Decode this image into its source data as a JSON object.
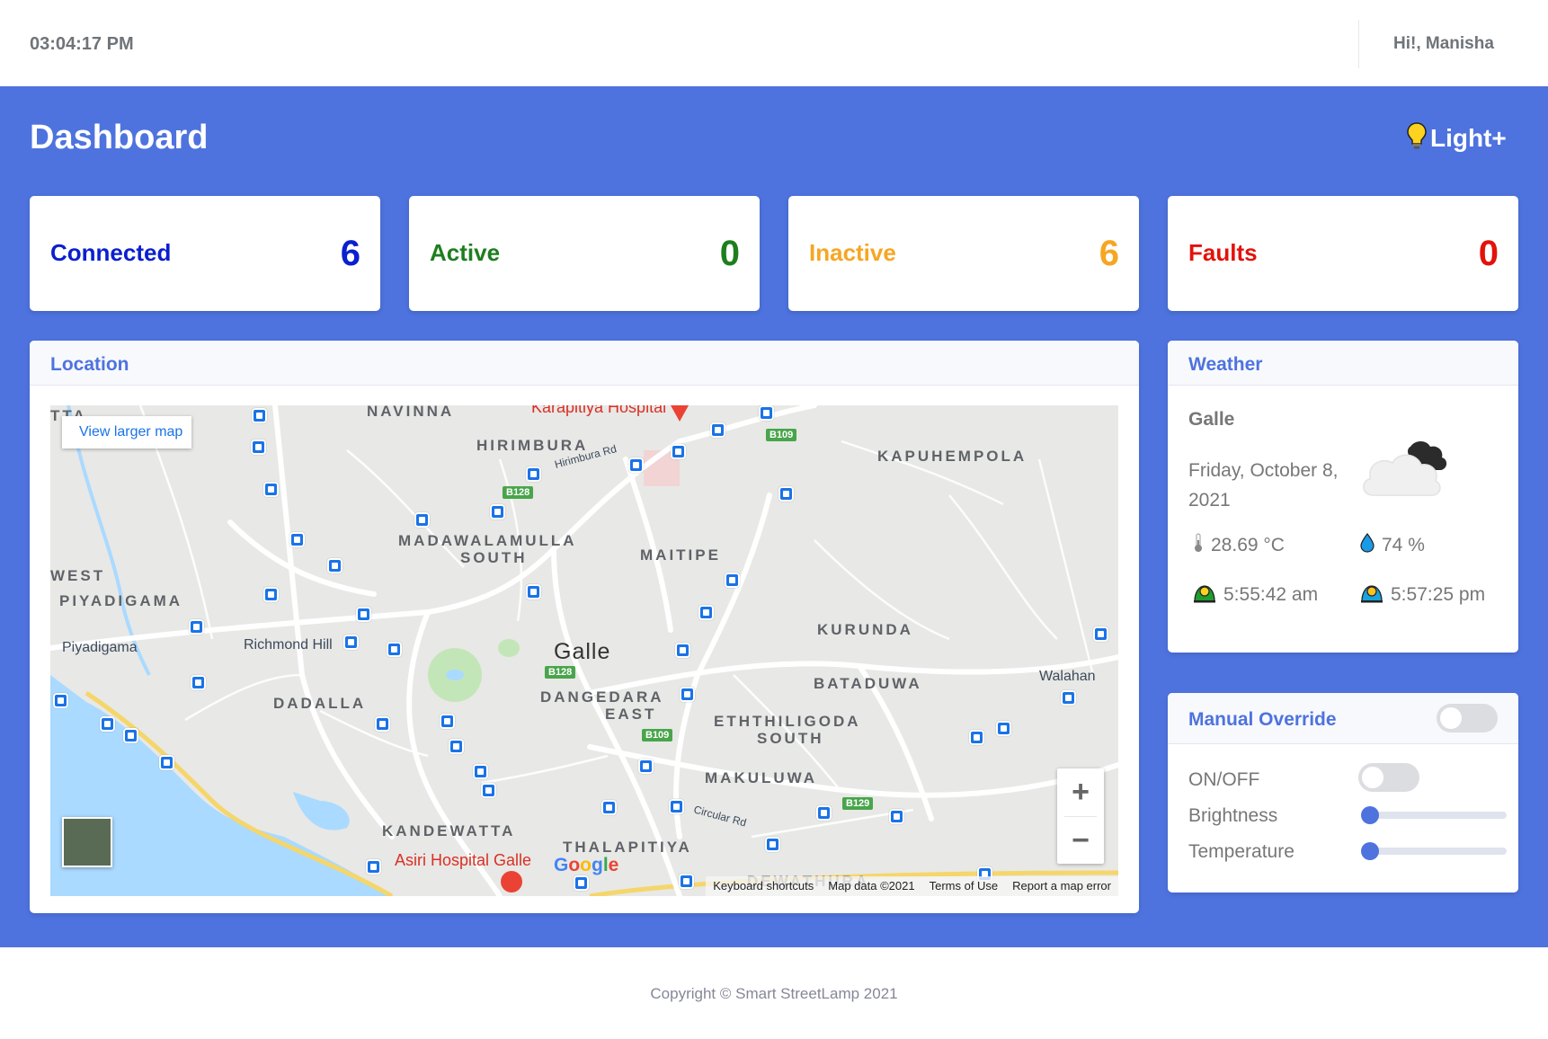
{
  "topbar": {
    "clock": "03:04:17 PM",
    "greeting": "Hi!, Manisha"
  },
  "page": {
    "title": "Dashboard",
    "brand": "Light+"
  },
  "stats": [
    {
      "label": "Connected",
      "value": "6",
      "color": "#0a1fcf"
    },
    {
      "label": "Active",
      "value": "0",
      "color": "#1e7e1e"
    },
    {
      "label": "Inactive",
      "value": "6",
      "color": "#f6a623"
    },
    {
      "label": "Faults",
      "value": "0",
      "color": "#e3120b"
    }
  ],
  "location": {
    "title": "Location",
    "larger_map": "View larger map",
    "city": "Galle",
    "areas": [
      "NAVINNA",
      "HIRIMBURA",
      "KAPUHEMPOLA",
      "MADAWALAMULLA",
      "SOUTH",
      "MAITIPE",
      "WEST",
      "PIYADIGAMA",
      "KURUNDA",
      "BATADUWA",
      "DADALLA",
      "DANGEDARA",
      "EAST",
      "ETHTHILIGODA",
      "SOUTH",
      "MAKULUWA",
      "KANDEWATTA",
      "THALAPITIYA",
      "DEWATHURA",
      "TTA"
    ],
    "towns": [
      "Piyadigama",
      "Richmond Hill",
      "Walahan"
    ],
    "roads": [
      "Hirimbura Rd",
      "Circular Rd"
    ],
    "road_badges": [
      "B109",
      "B128",
      "B128",
      "B109",
      "B129"
    ],
    "hospitals": [
      "Karapitiya Hospital",
      "Asiri Hospital Galle"
    ],
    "google": "Google",
    "footer": [
      "Keyboard shortcuts",
      "Map data ©2021",
      "Terms of Use",
      "Report a map error"
    ],
    "zoom_in": "+",
    "zoom_out": "−"
  },
  "weather": {
    "title": "Weather",
    "city": "Galle",
    "date": "Friday, October 8, 2021",
    "temperature": "28.69 °C",
    "humidity": "74 %",
    "sunrise": "5:55:42 am",
    "sunset": "5:57:25 pm"
  },
  "override": {
    "title": "Manual Override",
    "onoff": "ON/OFF",
    "brightness": "Brightness",
    "temperature": "Temperature",
    "override_enabled": false,
    "onoff_enabled": false,
    "brightness_level": 0,
    "temperature_level": 0
  },
  "footer": {
    "copyright": "Copyright © Smart StreetLamp 2021"
  }
}
